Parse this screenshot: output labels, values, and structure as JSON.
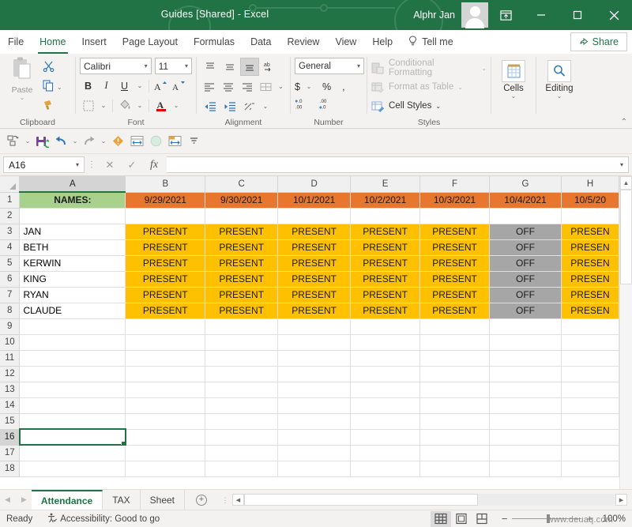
{
  "titlebar": {
    "title": "Guides  [Shared]  -  Excel",
    "user": "Alphr Jan",
    "ribbon_display_options": "ribbon-display-options-icon",
    "minimize": "minimize-icon",
    "restore": "restore-icon",
    "close": "close-icon"
  },
  "menu": {
    "items": [
      {
        "label": "File",
        "active": false
      },
      {
        "label": "Home",
        "active": true
      },
      {
        "label": "Insert",
        "active": false
      },
      {
        "label": "Page Layout",
        "active": false
      },
      {
        "label": "Formulas",
        "active": false
      },
      {
        "label": "Data",
        "active": false
      },
      {
        "label": "Review",
        "active": false
      },
      {
        "label": "View",
        "active": false
      },
      {
        "label": "Help",
        "active": false
      }
    ],
    "tell_me": "Tell me",
    "share": "Share"
  },
  "ribbon": {
    "groups": [
      {
        "label": "Clipboard"
      },
      {
        "label": "Font"
      },
      {
        "label": "Alignment"
      },
      {
        "label": "Number"
      },
      {
        "label": "Styles"
      }
    ],
    "clipboard": {
      "paste_label": "Paste",
      "cut": "scissors-icon",
      "copy": "copy-icon",
      "format_painter": "format-painter-icon"
    },
    "font": {
      "font_name": "Calibri",
      "font_size": "11",
      "bold": "B",
      "italic": "I",
      "underline": "U",
      "grow_font": "A",
      "shrink_font": "A"
    },
    "number": {
      "format": "General",
      "currency": "$",
      "percent": "%",
      "comma": ",",
      "increase_decimal": ".00",
      "decrease_decimal": ".00"
    },
    "styles": {
      "conditional_formatting": "Conditional Formatting",
      "format_as_table": "Format as Table",
      "cell_styles": "Cell Styles"
    },
    "cells": {
      "label": "Cells"
    },
    "editing": {
      "label": "Editing"
    }
  },
  "quick_access": {
    "items": [
      "autosave-toggle-icon",
      "save-icon",
      "undo-icon",
      "redo-icon",
      "error-checking-icon",
      "insert-rows-icon",
      "fill-color-icon",
      "merge-cells-icon",
      "customize-qat-icon"
    ]
  },
  "formula_bar": {
    "name_box": "A16",
    "cancel": "cancel-icon",
    "enter": "enter-icon",
    "insert_function": "fx",
    "value": ""
  },
  "sheet": {
    "columns": [
      "A",
      "B",
      "C",
      "D",
      "E",
      "F",
      "G",
      "H"
    ],
    "selected_column": "A",
    "selected_cell": "A16",
    "rows": [
      {
        "num": "1",
        "cells": [
          {
            "v": "NAMES:",
            "style": "c-hdr-green"
          },
          {
            "v": "9/29/2021",
            "style": "c-hdr-orange"
          },
          {
            "v": "9/30/2021",
            "style": "c-hdr-orange"
          },
          {
            "v": "10/1/2021",
            "style": "c-hdr-orange"
          },
          {
            "v": "10/2/2021",
            "style": "c-hdr-orange"
          },
          {
            "v": "10/3/2021",
            "style": "c-hdr-orange"
          },
          {
            "v": "10/4/2021",
            "style": "c-hdr-orange"
          },
          {
            "v": "10/5/20",
            "style": "c-hdr-orange"
          }
        ]
      },
      {
        "num": "2",
        "cells": [
          {
            "v": "",
            "style": "c-blank"
          },
          {
            "v": "",
            "style": "c-blank"
          },
          {
            "v": "",
            "style": "c-blank"
          },
          {
            "v": "",
            "style": "c-blank"
          },
          {
            "v": "",
            "style": "c-blank"
          },
          {
            "v": "",
            "style": "c-blank"
          },
          {
            "v": "",
            "style": "c-blank"
          },
          {
            "v": "",
            "style": "c-blank"
          }
        ]
      },
      {
        "num": "3",
        "cells": [
          {
            "v": "JAN",
            "style": "c-name"
          },
          {
            "v": "PRESENT",
            "style": "c-present"
          },
          {
            "v": "PRESENT",
            "style": "c-present"
          },
          {
            "v": "PRESENT",
            "style": "c-present"
          },
          {
            "v": "PRESENT",
            "style": "c-present"
          },
          {
            "v": "PRESENT",
            "style": "c-present"
          },
          {
            "v": "OFF",
            "style": "c-off"
          },
          {
            "v": "PRESEN",
            "style": "c-present"
          }
        ]
      },
      {
        "num": "4",
        "cells": [
          {
            "v": "BETH",
            "style": "c-name"
          },
          {
            "v": "PRESENT",
            "style": "c-present"
          },
          {
            "v": "PRESENT",
            "style": "c-present"
          },
          {
            "v": "PRESENT",
            "style": "c-present"
          },
          {
            "v": "PRESENT",
            "style": "c-present"
          },
          {
            "v": "PRESENT",
            "style": "c-present"
          },
          {
            "v": "OFF",
            "style": "c-off"
          },
          {
            "v": "PRESEN",
            "style": "c-present"
          }
        ]
      },
      {
        "num": "5",
        "cells": [
          {
            "v": "KERWIN",
            "style": "c-name"
          },
          {
            "v": "PRESENT",
            "style": "c-present"
          },
          {
            "v": "PRESENT",
            "style": "c-present"
          },
          {
            "v": "PRESENT",
            "style": "c-present"
          },
          {
            "v": "PRESENT",
            "style": "c-present"
          },
          {
            "v": "PRESENT",
            "style": "c-present"
          },
          {
            "v": "OFF",
            "style": "c-off"
          },
          {
            "v": "PRESEN",
            "style": "c-present"
          }
        ]
      },
      {
        "num": "6",
        "cells": [
          {
            "v": "KING",
            "style": "c-name"
          },
          {
            "v": "PRESENT",
            "style": "c-present"
          },
          {
            "v": "PRESENT",
            "style": "c-present"
          },
          {
            "v": "PRESENT",
            "style": "c-present"
          },
          {
            "v": "PRESENT",
            "style": "c-present"
          },
          {
            "v": "PRESENT",
            "style": "c-present"
          },
          {
            "v": "OFF",
            "style": "c-off"
          },
          {
            "v": "PRESEN",
            "style": "c-present"
          }
        ]
      },
      {
        "num": "7",
        "cells": [
          {
            "v": "RYAN",
            "style": "c-name"
          },
          {
            "v": "PRESENT",
            "style": "c-present"
          },
          {
            "v": "PRESENT",
            "style": "c-present"
          },
          {
            "v": "PRESENT",
            "style": "c-present"
          },
          {
            "v": "PRESENT",
            "style": "c-present"
          },
          {
            "v": "PRESENT",
            "style": "c-present"
          },
          {
            "v": "OFF",
            "style": "c-off"
          },
          {
            "v": "PRESEN",
            "style": "c-present"
          }
        ]
      },
      {
        "num": "8",
        "cells": [
          {
            "v": "CLAUDE",
            "style": "c-name"
          },
          {
            "v": "PRESENT",
            "style": "c-present"
          },
          {
            "v": "PRESENT",
            "style": "c-present"
          },
          {
            "v": "PRESENT",
            "style": "c-present"
          },
          {
            "v": "PRESENT",
            "style": "c-present"
          },
          {
            "v": "PRESENT",
            "style": "c-present"
          },
          {
            "v": "OFF",
            "style": "c-off"
          },
          {
            "v": "PRESEN",
            "style": "c-present"
          }
        ]
      },
      {
        "num": "9",
        "cells": [
          {
            "v": "",
            "style": "c-blank"
          },
          {
            "v": "",
            "style": "c-blank"
          },
          {
            "v": "",
            "style": "c-blank"
          },
          {
            "v": "",
            "style": "c-blank"
          },
          {
            "v": "",
            "style": "c-blank"
          },
          {
            "v": "",
            "style": "c-blank"
          },
          {
            "v": "",
            "style": "c-blank"
          },
          {
            "v": "",
            "style": "c-blank"
          }
        ]
      },
      {
        "num": "10",
        "cells": [
          {
            "v": "",
            "style": "c-blank"
          },
          {
            "v": "",
            "style": "c-blank"
          },
          {
            "v": "",
            "style": "c-blank"
          },
          {
            "v": "",
            "style": "c-blank"
          },
          {
            "v": "",
            "style": "c-blank"
          },
          {
            "v": "",
            "style": "c-blank"
          },
          {
            "v": "",
            "style": "c-blank"
          },
          {
            "v": "",
            "style": "c-blank"
          }
        ]
      },
      {
        "num": "11",
        "cells": [
          {
            "v": "",
            "style": "c-blank"
          },
          {
            "v": "",
            "style": "c-blank"
          },
          {
            "v": "",
            "style": "c-blank"
          },
          {
            "v": "",
            "style": "c-blank"
          },
          {
            "v": "",
            "style": "c-blank"
          },
          {
            "v": "",
            "style": "c-blank"
          },
          {
            "v": "",
            "style": "c-blank"
          },
          {
            "v": "",
            "style": "c-blank"
          }
        ]
      },
      {
        "num": "12",
        "cells": [
          {
            "v": "",
            "style": "c-blank"
          },
          {
            "v": "",
            "style": "c-blank"
          },
          {
            "v": "",
            "style": "c-blank"
          },
          {
            "v": "",
            "style": "c-blank"
          },
          {
            "v": "",
            "style": "c-blank"
          },
          {
            "v": "",
            "style": "c-blank"
          },
          {
            "v": "",
            "style": "c-blank"
          },
          {
            "v": "",
            "style": "c-blank"
          }
        ]
      },
      {
        "num": "13",
        "cells": [
          {
            "v": "",
            "style": "c-blank"
          },
          {
            "v": "",
            "style": "c-blank"
          },
          {
            "v": "",
            "style": "c-blank"
          },
          {
            "v": "",
            "style": "c-blank"
          },
          {
            "v": "",
            "style": "c-blank"
          },
          {
            "v": "",
            "style": "c-blank"
          },
          {
            "v": "",
            "style": "c-blank"
          },
          {
            "v": "",
            "style": "c-blank"
          }
        ]
      },
      {
        "num": "14",
        "cells": [
          {
            "v": "",
            "style": "c-blank"
          },
          {
            "v": "",
            "style": "c-blank"
          },
          {
            "v": "",
            "style": "c-blank"
          },
          {
            "v": "",
            "style": "c-blank"
          },
          {
            "v": "",
            "style": "c-blank"
          },
          {
            "v": "",
            "style": "c-blank"
          },
          {
            "v": "",
            "style": "c-blank"
          },
          {
            "v": "",
            "style": "c-blank"
          }
        ]
      },
      {
        "num": "15",
        "cells": [
          {
            "v": "",
            "style": "c-blank"
          },
          {
            "v": "",
            "style": "c-blank"
          },
          {
            "v": "",
            "style": "c-blank"
          },
          {
            "v": "",
            "style": "c-blank"
          },
          {
            "v": "",
            "style": "c-blank"
          },
          {
            "v": "",
            "style": "c-blank"
          },
          {
            "v": "",
            "style": "c-blank"
          },
          {
            "v": "",
            "style": "c-blank"
          }
        ]
      },
      {
        "num": "16",
        "selected": 0,
        "cells": [
          {
            "v": "",
            "style": "c-blank"
          },
          {
            "v": "",
            "style": "c-blank"
          },
          {
            "v": "",
            "style": "c-blank"
          },
          {
            "v": "",
            "style": "c-blank"
          },
          {
            "v": "",
            "style": "c-blank"
          },
          {
            "v": "",
            "style": "c-blank"
          },
          {
            "v": "",
            "style": "c-blank"
          },
          {
            "v": "",
            "style": "c-blank"
          }
        ]
      },
      {
        "num": "17",
        "cells": [
          {
            "v": "",
            "style": "c-blank"
          },
          {
            "v": "",
            "style": "c-blank"
          },
          {
            "v": "",
            "style": "c-blank"
          },
          {
            "v": "",
            "style": "c-blank"
          },
          {
            "v": "",
            "style": "c-blank"
          },
          {
            "v": "",
            "style": "c-blank"
          },
          {
            "v": "",
            "style": "c-blank"
          },
          {
            "v": "",
            "style": "c-blank"
          }
        ]
      },
      {
        "num": "18",
        "cells": [
          {
            "v": "",
            "style": "c-blank"
          },
          {
            "v": "",
            "style": "c-blank"
          },
          {
            "v": "",
            "style": "c-blank"
          },
          {
            "v": "",
            "style": "c-blank"
          },
          {
            "v": "",
            "style": "c-blank"
          },
          {
            "v": "",
            "style": "c-blank"
          },
          {
            "v": "",
            "style": "c-blank"
          },
          {
            "v": "",
            "style": "c-blank"
          }
        ]
      }
    ]
  },
  "sheet_tabs": {
    "tabs": [
      {
        "label": "Attendance",
        "active": true
      },
      {
        "label": "TAX",
        "active": false
      },
      {
        "label": "Sheet",
        "active": false
      }
    ],
    "add_label": "+"
  },
  "status": {
    "ready": "Ready",
    "accessibility": "Accessibility: Good to go",
    "zoom": "100%",
    "views": [
      "normal-view-icon",
      "page-layout-view-icon",
      "page-break-view-icon"
    ]
  },
  "watermark": "www.deuaq.com",
  "colors": {
    "brand_green": "#217346",
    "header_green": "#a9d18e",
    "header_orange": "#e8762c",
    "present_gold": "#ffc000",
    "off_gray": "#a6a6a6"
  }
}
